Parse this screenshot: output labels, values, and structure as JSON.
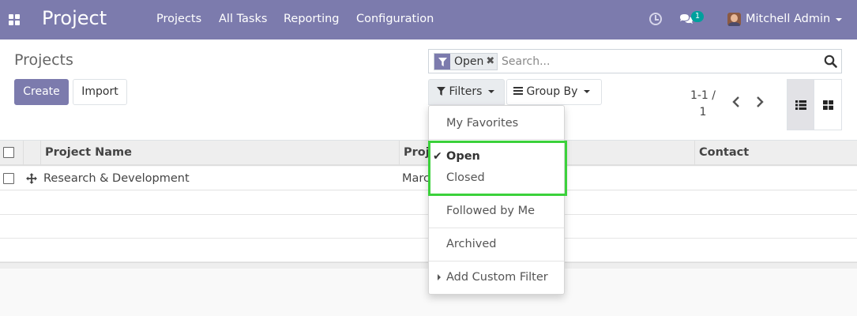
{
  "navbar": {
    "brand": "Project",
    "menu": [
      "Projects",
      "All Tasks",
      "Reporting",
      "Configuration"
    ],
    "chat_count": "1",
    "user": "Mitchell Admin"
  },
  "control_panel": {
    "breadcrumb": "Projects",
    "create_label": "Create",
    "import_label": "Import",
    "facet_label": "Open",
    "search_placeholder": "Search...",
    "filters_label": "Filters",
    "groupby_label": "Group By",
    "pager_value": "1-1 /",
    "pager_limit": "1"
  },
  "list": {
    "columns": [
      "Project Name",
      "Proj",
      "Contact"
    ],
    "rows": [
      {
        "name": "Research & Development",
        "partial": "Marc"
      }
    ]
  },
  "filters_menu": {
    "items": [
      "My Favorites",
      "Open",
      "Closed",
      "Followed by Me",
      "Archived",
      "Add Custom Filter"
    ]
  },
  "colors": {
    "brand": "#7c7bad",
    "badge": "#00a09d",
    "highlight": "#3bd13b"
  }
}
